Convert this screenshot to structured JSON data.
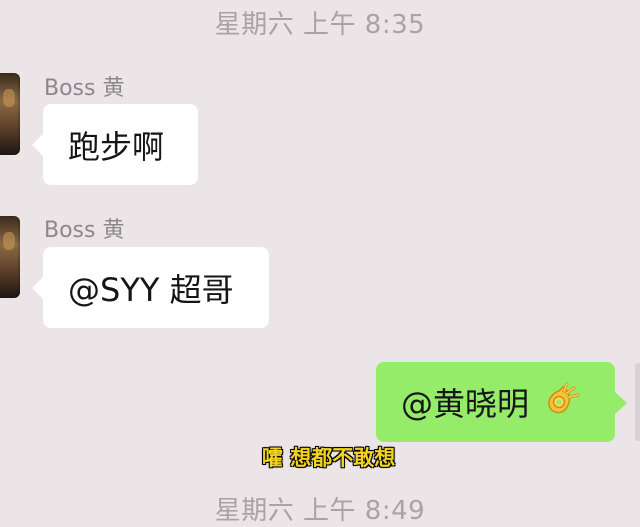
{
  "timestamps": {
    "top": "星期六 上午 8:35",
    "bottom": "星期六 上午 8:49"
  },
  "messages": [
    {
      "sender": "Boss 黄",
      "text": "跑步啊",
      "side": "left",
      "bubble_color": "#ffffff"
    },
    {
      "sender": "Boss 黄",
      "text": "@SYY 超哥",
      "side": "left",
      "bubble_color": "#ffffff"
    },
    {
      "text": "@黄晓明",
      "emoji": "ok-hand-icon",
      "side": "right",
      "bubble_color": "#95ec69"
    }
  ],
  "subtitle": {
    "text": "嚯 想都不敢想",
    "color": "#f1d31f"
  },
  "colors": {
    "background": "#ebe5e8",
    "incoming_bubble": "#ffffff",
    "outgoing_bubble": "#95ec69",
    "timestamp": "#a8a3a6",
    "sender_name": "#8b888b"
  }
}
